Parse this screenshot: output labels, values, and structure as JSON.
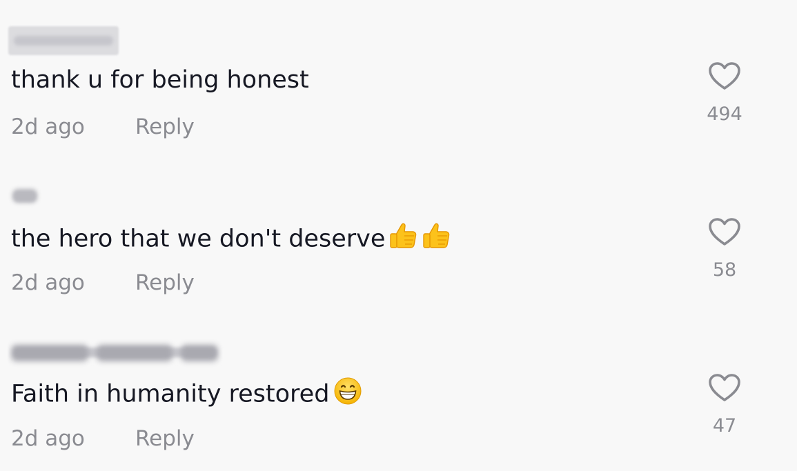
{
  "comments": [
    {
      "text": "thank u for being honest",
      "timestamp": "2d ago",
      "reply_label": "Reply",
      "likes": "494",
      "emojis": []
    },
    {
      "text": "the hero that we don't deserve",
      "timestamp": "2d ago",
      "reply_label": "Reply",
      "likes": "58",
      "emojis": [
        "thumbs-up",
        "thumbs-up"
      ]
    },
    {
      "text": "Faith in humanity restored",
      "timestamp": "2d ago",
      "reply_label": "Reply",
      "likes": "47",
      "emojis": [
        "grinning-face"
      ]
    }
  ],
  "colors": {
    "background": "#f8f8f8",
    "text": "#161823",
    "secondary": "#8a8b91",
    "emoji_yellow": "#fcc21b"
  },
  "icons": {
    "like": "heart-outline-icon"
  }
}
